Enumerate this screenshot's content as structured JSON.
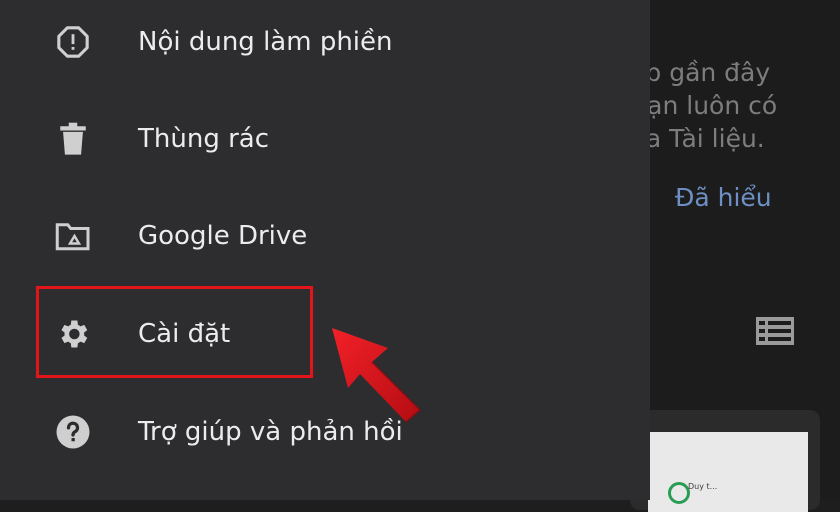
{
  "background": {
    "text_lines": [
      "ệp gần đây",
      "Bạn luôn có",
      "ủa Tài liệu."
    ],
    "link": "Đã hiểu",
    "list_icon": "list-view-icon",
    "thumbnail_text": "Duy t..."
  },
  "drawer": {
    "items": [
      {
        "label": "Nội dung làm phiền",
        "icon": "spam-octagon-icon"
      },
      {
        "label": "Thùng rác",
        "icon": "trash-icon"
      },
      {
        "label": "Google Drive",
        "icon": "drive-folder-icon"
      },
      {
        "label": "Cài đặt",
        "icon": "gear-icon"
      },
      {
        "label": "Trợ giúp và phản hồi",
        "icon": "help-circle-icon"
      }
    ]
  },
  "annotation": {
    "highlight_color": "#e3151a",
    "arrow_color": "#d8131a"
  }
}
